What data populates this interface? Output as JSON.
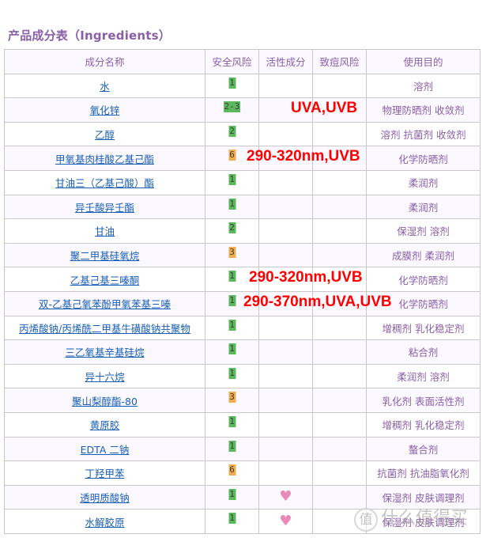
{
  "title": "产品成分表（Ingredients）",
  "table": {
    "headers": [
      "成分名称",
      "安全风险",
      "活性成分",
      "致痘风险",
      "使用目的"
    ],
    "rows": [
      {
        "name": "水",
        "risk": "1",
        "risk_level": "green",
        "active": "",
        "acne": "",
        "purpose": "溶剂"
      },
      {
        "name": "氧化锌",
        "risk": "2-3",
        "risk_level": "green",
        "active": "",
        "acne": "",
        "purpose": "物理防晒剂 收敛剂"
      },
      {
        "name": "乙醇",
        "risk": "2",
        "risk_level": "green",
        "active": "",
        "acne": "",
        "purpose": "溶剂 抗菌剂 收敛剂"
      },
      {
        "name": "甲氧基肉桂酸乙基己酯",
        "risk": "6",
        "risk_level": "orange",
        "active": "",
        "acne": "",
        "purpose": "化学防晒剂"
      },
      {
        "name": "甘油三（乙基己酸）酯",
        "risk": "1",
        "risk_level": "green",
        "active": "",
        "acne": "",
        "purpose": "柔润剂"
      },
      {
        "name": "异壬酸异壬酯",
        "risk": "1",
        "risk_level": "green",
        "active": "",
        "acne": "",
        "purpose": "柔润剂"
      },
      {
        "name": "甘油",
        "risk": "2",
        "risk_level": "green",
        "active": "",
        "acne": "",
        "purpose": "保湿剂 溶剂"
      },
      {
        "name": "聚二甲基硅氧烷",
        "risk": "3",
        "risk_level": "orange",
        "active": "",
        "acne": "",
        "purpose": "成膜剂 柔润剂"
      },
      {
        "name": "乙基己基三嗪酮",
        "risk": "1",
        "risk_level": "green",
        "active": "",
        "acne": "",
        "purpose": "化学防晒剂"
      },
      {
        "name": "双-乙基己氧苯酚甲氧苯基三嗪",
        "risk": "1",
        "risk_level": "green",
        "active": "",
        "acne": "",
        "purpose": "化学防晒剂"
      },
      {
        "name": "丙烯酸钠/丙烯酰二甲基牛磺酸钠共聚物",
        "risk": "1",
        "risk_level": "green",
        "active": "",
        "acne": "",
        "purpose": "增稠剂 乳化稳定剂"
      },
      {
        "name": "三乙氧基辛基硅烷",
        "risk": "1",
        "risk_level": "green",
        "active": "",
        "acne": "",
        "purpose": "粘合剂"
      },
      {
        "name": "异十六烷",
        "risk": "1",
        "risk_level": "green",
        "active": "",
        "acne": "",
        "purpose": "柔润剂 溶剂"
      },
      {
        "name": "聚山梨醇酯-80",
        "risk": "3",
        "risk_level": "orange",
        "active": "",
        "acne": "",
        "purpose": "乳化剂 表面活性剂"
      },
      {
        "name": "黄原胶",
        "risk": "1",
        "risk_level": "green",
        "active": "",
        "acne": "",
        "purpose": "增稠剂 乳化稳定剂"
      },
      {
        "name": "EDTA 二钠",
        "risk": "1",
        "risk_level": "green",
        "active": "",
        "acne": "",
        "purpose": "螯合剂"
      },
      {
        "name": "丁羟甲苯",
        "risk": "6",
        "risk_level": "orange",
        "active": "",
        "acne": "",
        "purpose": "抗菌剂 抗油脂氧化剂"
      },
      {
        "name": "透明质酸钠",
        "risk": "1",
        "risk_level": "green",
        "active": "heart",
        "acne": "",
        "purpose": "保湿剂 皮肤调理剂"
      },
      {
        "name": "水解胶原",
        "risk": "1",
        "risk_level": "green",
        "active": "heart",
        "acne": "",
        "purpose": "保湿剂 皮肤调理剂"
      }
    ]
  },
  "annotations": [
    {
      "row": 1,
      "text": "UVA,UVB"
    },
    {
      "row": 3,
      "text": "290-320nm,UVB"
    },
    {
      "row": 8,
      "text": "290-320nm,UVB"
    },
    {
      "row": 9,
      "text": "290-370nm,UVA,UVB"
    }
  ],
  "watermark": {
    "icon": "值",
    "text": "什么值得买"
  },
  "colors": {
    "title": "#8a5fa8",
    "link": "#1a5fb4",
    "badge_green": "#5cb85c",
    "badge_orange": "#f0ad4e",
    "annotation": "#ff0000",
    "heart": "#ea8ab8"
  }
}
